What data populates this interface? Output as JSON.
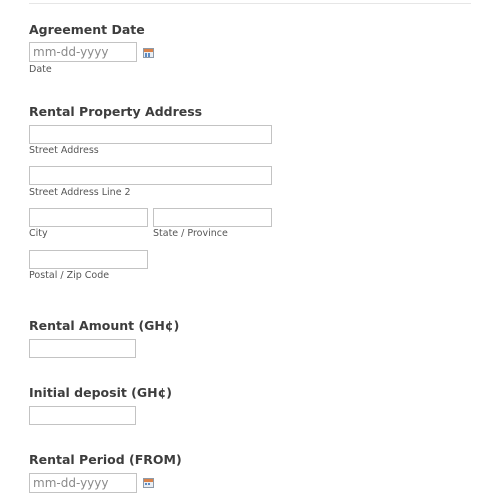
{
  "agreement_date": {
    "label": "Agreement Date",
    "placeholder": "mm-dd-yyyy",
    "sublabel": "Date"
  },
  "address": {
    "label": "Rental Property Address",
    "street_label": "Street Address",
    "street2_label": "Street Address Line 2",
    "city_label": "City",
    "state_label": "State / Province",
    "zip_label": "Postal / Zip Code"
  },
  "rental_amount": {
    "label": "Rental Amount (GH¢)"
  },
  "initial_deposit": {
    "label": "Initial deposit (GH¢)"
  },
  "rental_period_from": {
    "label": "Rental Period (FROM)",
    "placeholder": "mm-dd-yyyy"
  },
  "icons": {
    "calendar": "calendar-icon"
  },
  "colors": {
    "text": "#3d3d3d",
    "border": "#c3c3c3",
    "calendar_accent": "#d9824a"
  }
}
